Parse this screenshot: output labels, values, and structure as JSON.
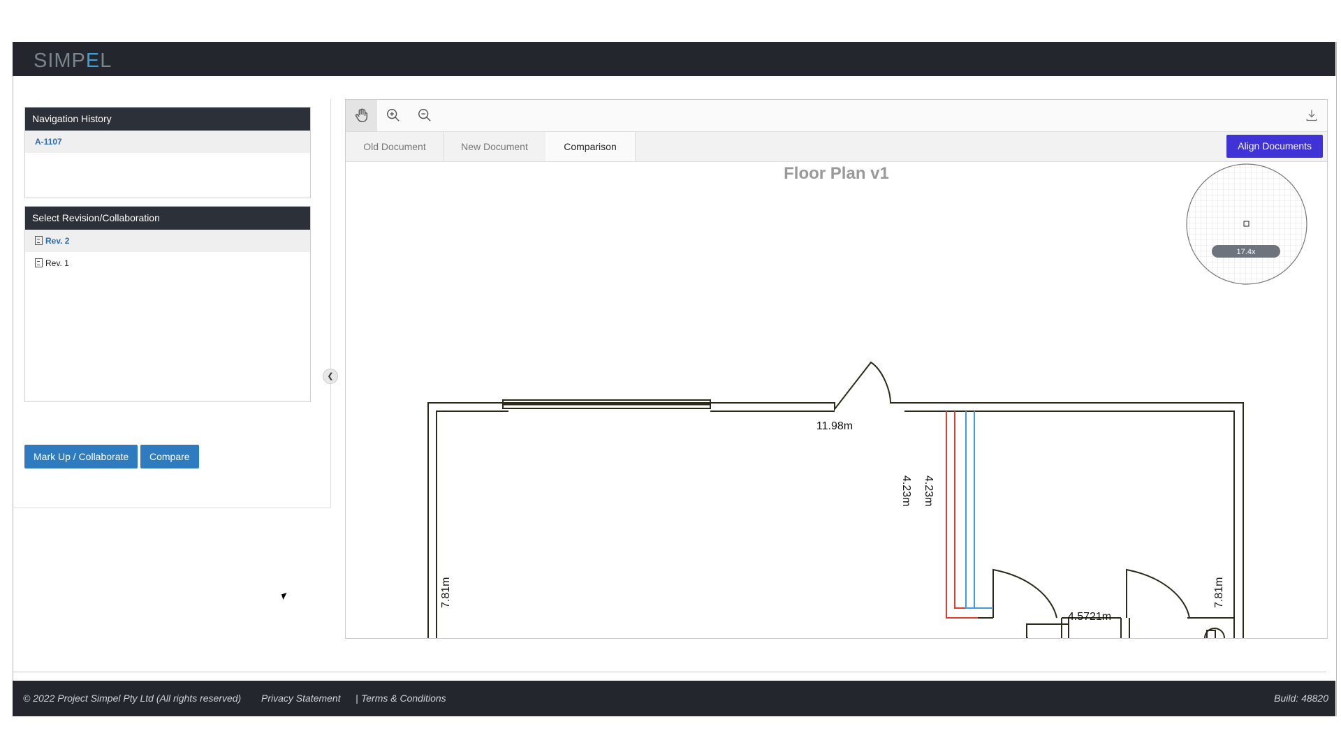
{
  "app": {
    "logo_prefix": "SIMP",
    "logo_e": "E",
    "logo_suffix": "L"
  },
  "navigation_history": {
    "title": "Navigation History",
    "items": [
      {
        "label": "A-1107",
        "active": true
      }
    ]
  },
  "revisions": {
    "title": "Select Revision/Collaboration",
    "items": [
      {
        "label": "Rev. 2",
        "active": true
      },
      {
        "label": "Rev. 1",
        "active": false
      }
    ]
  },
  "actions": {
    "markup_label": "Mark Up / Collaborate",
    "compare_label": "Compare"
  },
  "toolbar": {
    "icons": [
      "hand-icon",
      "zoom-in-icon",
      "zoom-out-icon",
      "download-icon"
    ]
  },
  "tabs": [
    {
      "label": "Old Document",
      "selected": false
    },
    {
      "label": "New Document",
      "selected": false
    },
    {
      "label": "Comparison",
      "selected": true
    }
  ],
  "align_label": "Align Documents",
  "plan": {
    "title": "Floor Plan v1",
    "dims": {
      "top": "11.98m",
      "mid_left": "4.23m",
      "mid_right": "4.23m",
      "left_side": "7.81m",
      "right_side": "7.81m",
      "bottom": "4.5721m"
    },
    "zoom": "17.4x",
    "colors": {
      "old": "#e53b2c",
      "new": "#3b9be3",
      "wall": "#2b2a1a"
    }
  },
  "footer": {
    "copyright": "© 2022 Project Simpel Pty Ltd (All rights reserved)",
    "privacy": "Privacy Statement",
    "separator": "|",
    "terms": "Terms & Conditions",
    "build": "Build: 48820"
  }
}
